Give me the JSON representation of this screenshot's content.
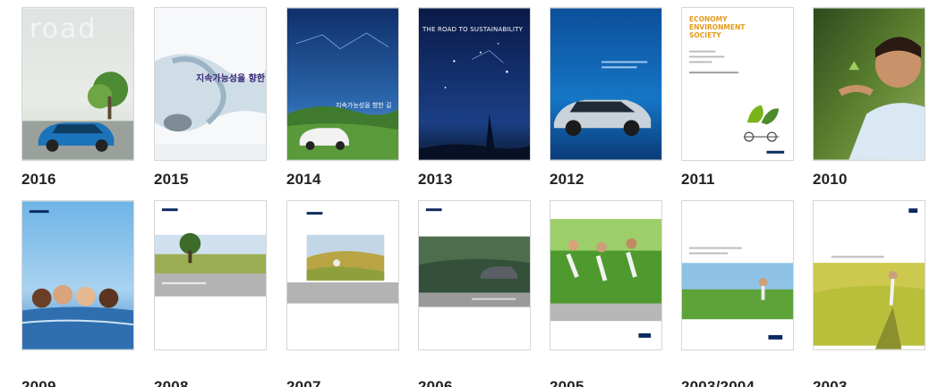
{
  "reports": [
    {
      "year": "2016",
      "cover_text": "road"
    },
    {
      "year": "2015",
      "cover_text": "지속가능성을 향한 길"
    },
    {
      "year": "2014",
      "cover_text": "지속가능성을 향한 길"
    },
    {
      "year": "2013",
      "cover_text": "THE ROAD TO SUSTAINABILITY"
    },
    {
      "year": "2012",
      "cover_text": ""
    },
    {
      "year": "2011",
      "cover_text": "ECONOMY ENVIRONMENT SOCIETY"
    },
    {
      "year": "2010",
      "cover_text": ""
    },
    {
      "year": "2009",
      "cover_text": ""
    },
    {
      "year": "2008",
      "cover_text": ""
    },
    {
      "year": "2007",
      "cover_text": ""
    },
    {
      "year": "2006",
      "cover_text": ""
    },
    {
      "year": "2005",
      "cover_text": ""
    },
    {
      "year": "2003/2004",
      "cover_text": ""
    },
    {
      "year": "2003",
      "cover_text": ""
    }
  ],
  "colors": {
    "year_text": "#222222",
    "cover_border": "#d6d6d6",
    "blue_dark": "#0b2a5e",
    "blue_light": "#1e6fb8",
    "green": "#4e8b2a",
    "eco_green": "#7ab317",
    "eco_orange": "#e59a1b"
  }
}
